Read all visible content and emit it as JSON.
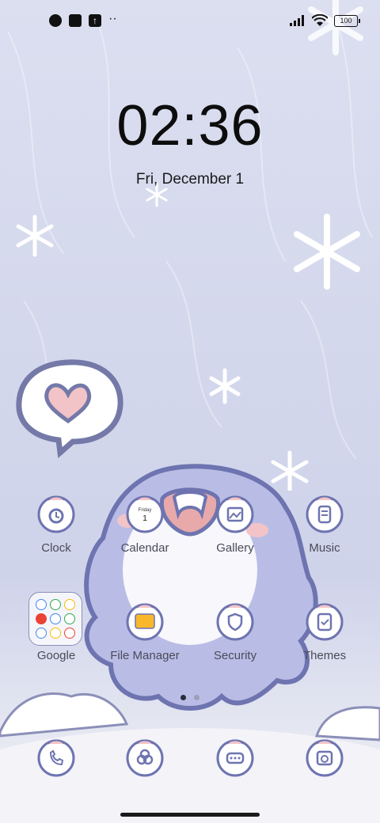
{
  "status_bar": {
    "battery": "100"
  },
  "lock": {
    "time": "02:36",
    "date": "Fri, December 1"
  },
  "apps": [
    {
      "name": "clock",
      "label": "Clock"
    },
    {
      "name": "calendar",
      "label": "Calendar",
      "badge_day": "Friday",
      "badge_num": "1"
    },
    {
      "name": "gallery",
      "label": "Gallery"
    },
    {
      "name": "music",
      "label": "Music"
    },
    {
      "name": "google",
      "label": "Google"
    },
    {
      "name": "file-manager",
      "label": "File Manager"
    },
    {
      "name": "security",
      "label": "Security"
    },
    {
      "name": "themes",
      "label": "Themes"
    }
  ],
  "dock": [
    {
      "name": "phone",
      "icon": "phone-icon"
    },
    {
      "name": "contacts",
      "icon": "contacts-icon"
    },
    {
      "name": "messages",
      "icon": "messages-icon"
    },
    {
      "name": "camera",
      "icon": "camera-icon"
    }
  ],
  "page_indicator": {
    "pages": 2,
    "active": 1
  },
  "colors": {
    "accent": "#7b82c4",
    "label": "#4a4b58",
    "mascot": "#b9bde6"
  }
}
